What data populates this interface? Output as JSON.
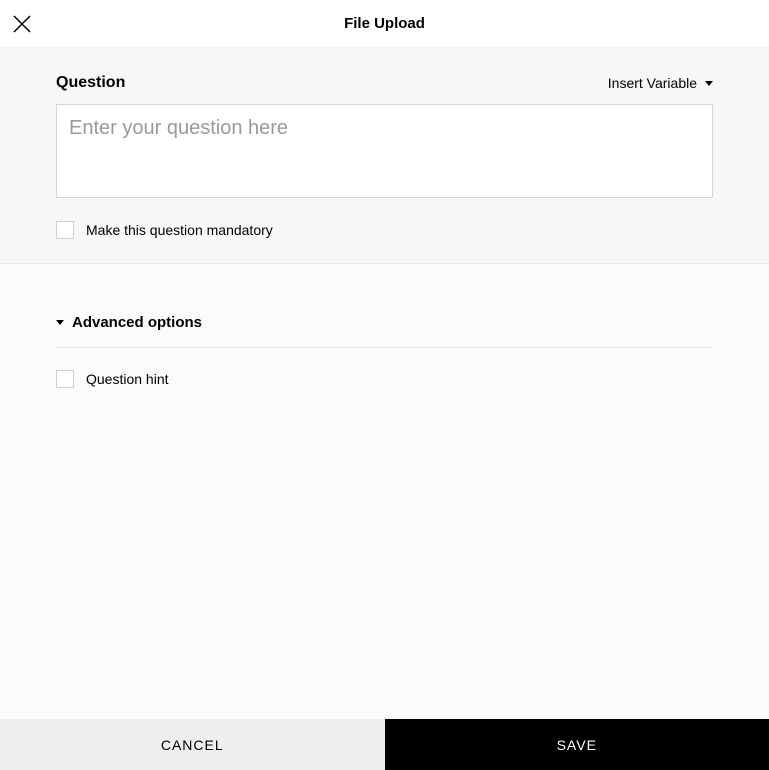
{
  "header": {
    "title": "File Upload"
  },
  "question": {
    "label": "Question",
    "insertVariable": "Insert Variable",
    "placeholder": "Enter your question here",
    "value": "",
    "mandatoryLabel": "Make this question mandatory"
  },
  "advanced": {
    "title": "Advanced options",
    "hintLabel": "Question hint"
  },
  "footer": {
    "cancel": "CANCEL",
    "save": "SAVE"
  }
}
